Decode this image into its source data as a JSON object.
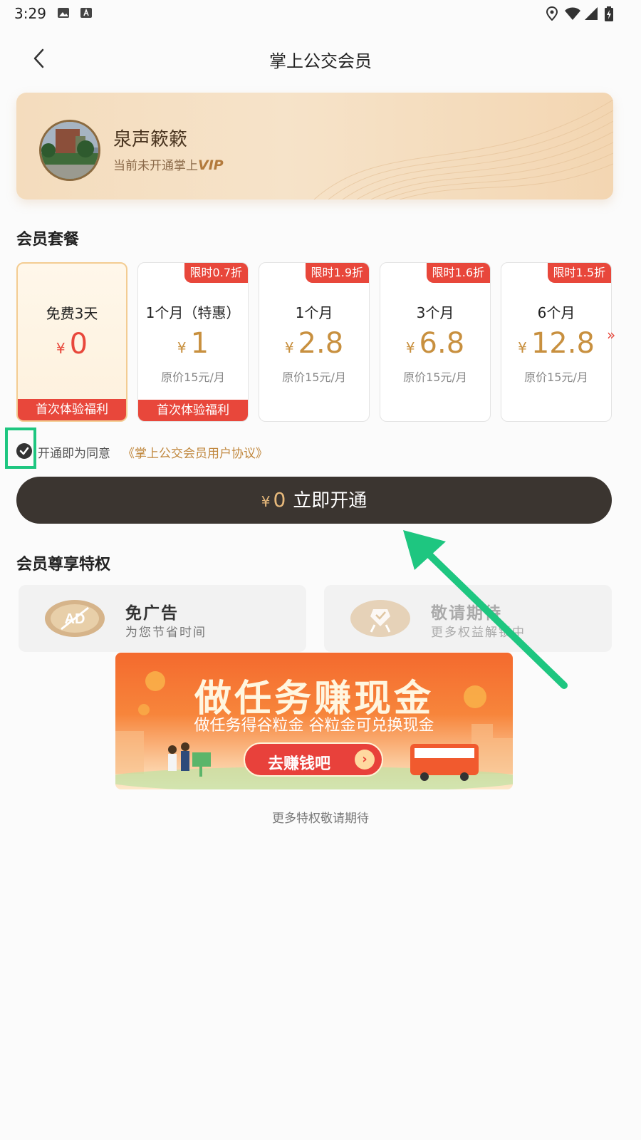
{
  "status_bar": {
    "time": "3:29"
  },
  "header": {
    "title": "掌上公交会员"
  },
  "profile": {
    "name": "泉声簌簌",
    "status_text": "当前未开通掌上",
    "vip_label": "VIP"
  },
  "plans_section": {
    "title": "会员套餐",
    "plans": [
      {
        "name": "免费3天",
        "currency": "¥",
        "price": "0",
        "original": "",
        "tag": "",
        "bottom": "首次体验福利",
        "selected": true
      },
      {
        "name": "1个月（特惠）",
        "currency": "¥",
        "price": "1",
        "original": "原价15元/月",
        "tag": "限时0.7折",
        "bottom": "首次体验福利",
        "selected": false
      },
      {
        "name": "1个月",
        "currency": "¥",
        "price": "2.8",
        "original": "原价15元/月",
        "tag": "限时1.9折",
        "bottom": "",
        "selected": false
      },
      {
        "name": "3个月",
        "currency": "¥",
        "price": "6.8",
        "original": "原价15元/月",
        "tag": "限时1.6折",
        "bottom": "",
        "selected": false
      },
      {
        "name": "6个月",
        "currency": "¥",
        "price": "12.8",
        "original": "原价15元/月",
        "tag": "限时1.5折",
        "bottom": "",
        "selected": false
      }
    ],
    "more_arrow": "»"
  },
  "agreement": {
    "checked": true,
    "text": "开通即为同意",
    "link": "《掌上公交会员用户协议》"
  },
  "buy_button": {
    "currency": "¥",
    "amount": "0",
    "label": "立即开通"
  },
  "privileges": {
    "title": "会员尊享特权",
    "items": [
      {
        "title": "免广告",
        "subtitle": "为您节省时间",
        "icon": "no-ad-icon"
      },
      {
        "title": "敬请期待",
        "subtitle": "更多权益解锁中",
        "icon": "badge-icon"
      }
    ]
  },
  "banner": {
    "title": "做任务赚现金",
    "subtitle": "做任务得谷粒金 谷粒金可兑换现金",
    "button": "去赚钱吧"
  },
  "footer": {
    "text": "更多特权敬请期待"
  },
  "colors": {
    "accent_red": "#e8473b",
    "gold": "#c8903f",
    "dark_button": "#3b3530",
    "highlight_green": "#1ec680"
  }
}
